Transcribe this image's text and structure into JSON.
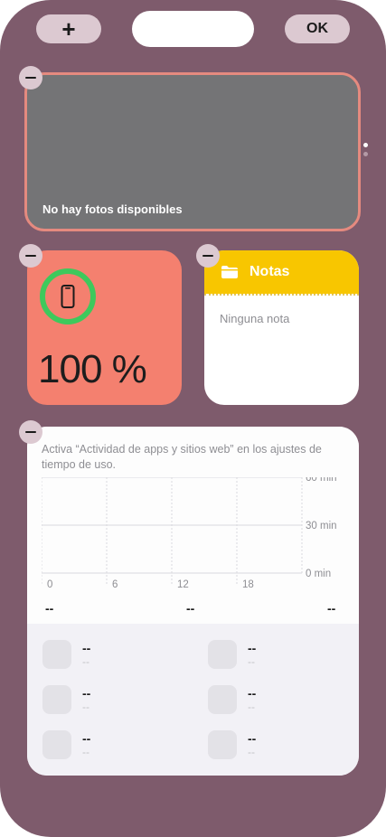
{
  "header": {
    "add_label": "+",
    "done_label": "OK"
  },
  "photos": {
    "empty_text": "No hay fotos disponibles"
  },
  "battery": {
    "level_text": "100 %",
    "level": 1.0,
    "icon": "iphone-icon",
    "ring_color": "#3ec95c"
  },
  "notes": {
    "title": "Notas",
    "empty_text": "Ninguna nota",
    "icon": "folder-icon",
    "accent": "#f8c600"
  },
  "screen_time": {
    "message": "Activa “Actividad de apps y sitios web” en los ajustes de tiempo de uso.",
    "totals": [
      "--",
      "--",
      "--"
    ],
    "apps": [
      {
        "name": "--",
        "time": "--"
      },
      {
        "name": "--",
        "time": "--"
      },
      {
        "name": "--",
        "time": "--"
      },
      {
        "name": "--",
        "time": "--"
      },
      {
        "name": "--",
        "time": "--"
      },
      {
        "name": "--",
        "time": "--"
      }
    ]
  },
  "chart_data": {
    "type": "bar",
    "x_ticks": [
      "0",
      "6",
      "12",
      "18"
    ],
    "y_ticks": [
      "60 min",
      "30 min",
      "0 min"
    ],
    "ylim": [
      0,
      60
    ],
    "values": [],
    "grid": true
  },
  "colors": {
    "background": "#7e5b6c",
    "photo_border": "#e58a7f",
    "battery_bg": "#f4806f"
  }
}
